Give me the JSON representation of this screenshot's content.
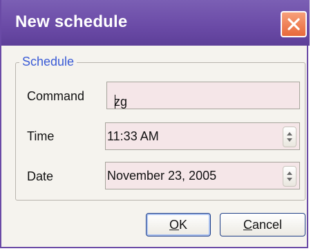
{
  "dialog": {
    "title": "New schedule",
    "close_icon": "close-icon"
  },
  "schedule_group": {
    "legend": "Schedule",
    "command": {
      "label": "Command",
      "value": "zg"
    },
    "time": {
      "label": "Time",
      "value": "11:33 AM",
      "spinner_icon": "spinner-up-down-icon"
    },
    "date": {
      "label": "Date",
      "value": "November 23, 2005",
      "spinner_icon": "spinner-up-down-icon"
    }
  },
  "buttons": {
    "ok": {
      "mnemonic": "O",
      "rest": "K"
    },
    "cancel": {
      "mnemonic": "C",
      "rest": "ancel"
    }
  },
  "colors": {
    "titlebar": "#6a4aa6",
    "close_button": "#e8683a",
    "field_background": "#f5e6e8",
    "legend_text": "#3a5bd6",
    "window_background": "#f5f3ee"
  }
}
